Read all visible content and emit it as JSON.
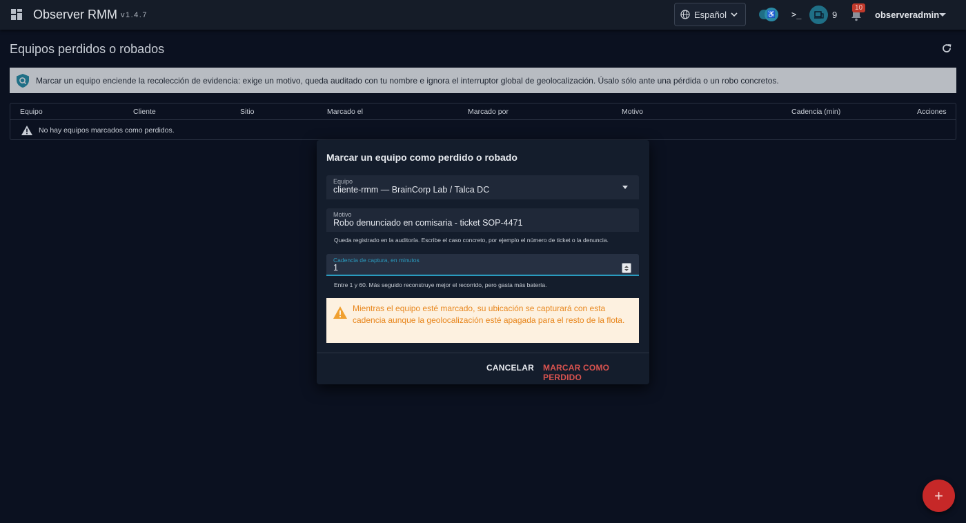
{
  "app": {
    "title": "Observer RMM",
    "version": "v1.4.7"
  },
  "topbar": {
    "language": "Español",
    "agent_count": "9",
    "notification_count": "10",
    "username": "observeradmin",
    "terminal_glyph": ">_"
  },
  "page": {
    "title": "Equipos perdidos o robados"
  },
  "banner": {
    "text": "Marcar un equipo enciende la recolección de evidencia: exige un motivo, queda auditado con tu nombre e ignora el interruptor global de geolocalización. Úsalo sólo ante una pérdida o un robo concretos."
  },
  "table": {
    "columns": [
      "Equipo",
      "Cliente",
      "Sitio",
      "Marcado el",
      "Marcado por",
      "Motivo",
      "Cadencia (min)",
      "Acciones"
    ],
    "empty_text": "No hay equipos marcados como perdidos."
  },
  "dialog": {
    "title": "Marcar un equipo como perdido o robado",
    "equipo_label": "Equipo",
    "equipo_value": "cliente-rmm — BrainCorp Lab / Talca DC",
    "motivo_label": "Motivo",
    "motivo_value": "Robo denunciado en comisaria - ticket SOP-4471",
    "motivo_hint": "Queda registrado en la auditoría. Escribe el caso concreto, por ejemplo el número de ticket o la denuncia.",
    "cadencia_label": "Cadencia de captura, en minutos",
    "cadencia_value": "1",
    "cadencia_hint": "Entre 1 y 60. Más seguido reconstruye mejor el recorrido, pero gasta más batería.",
    "alert_text": "Mientras el equipo esté marcado, su ubicación se capturará con esta cadencia aunque la geolocalización esté apagada para el resto de la flota.",
    "cancel_label": "CANCELAR",
    "confirm_label": "MARCAR COMO PERDIDO"
  },
  "fab": {
    "label": "+"
  },
  "colors": {
    "background": "#0b1120",
    "topbar": "#151c28",
    "accent": "#2a9bbf",
    "danger": "#c62828",
    "warning": "#e8871e"
  }
}
